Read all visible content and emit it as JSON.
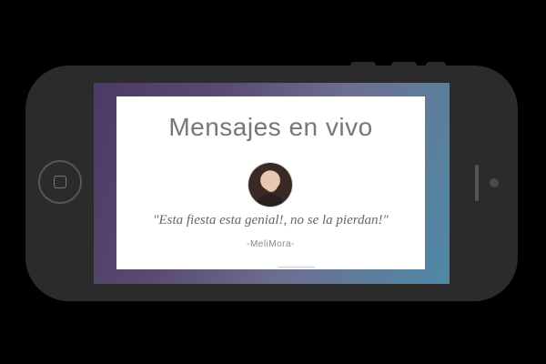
{
  "widget": {
    "title": "Mensajes en vivo",
    "message": {
      "quote": "\"Esta fiesta esta genial!, no se la pierdan!\"",
      "author": "-MeliMora-"
    }
  },
  "colors": {
    "background": "#000000",
    "phone_body": "#2b2b2b",
    "screen_gradient_start": "#4c3a66",
    "screen_gradient_end": "#4e89a6",
    "card": "#ffffff",
    "title_text": "#777777"
  },
  "icons": {
    "home_button": "home-button-icon",
    "avatar": "user-avatar-photo"
  }
}
